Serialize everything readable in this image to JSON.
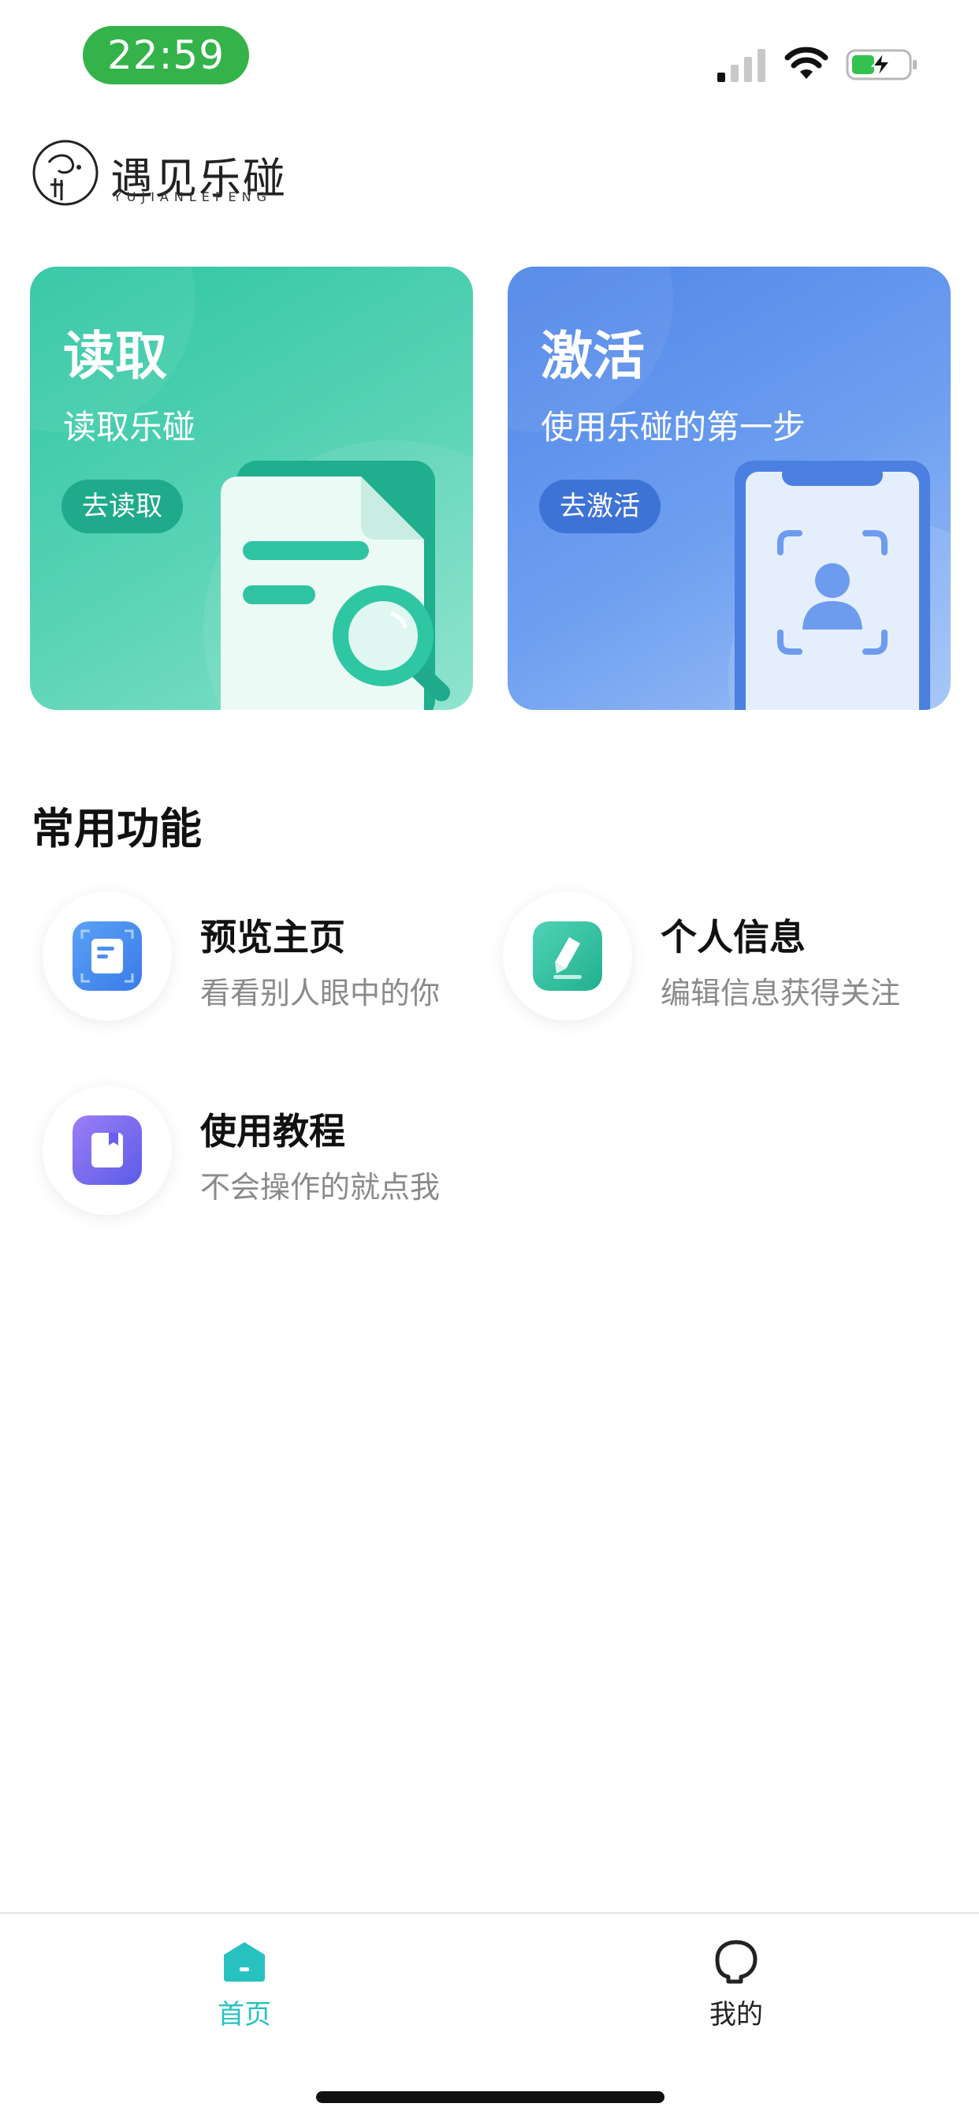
{
  "status_bar": {
    "time": "22:59",
    "icons": [
      "cellular-signal-icon",
      "wifi-icon",
      "battery-charging-icon"
    ],
    "time_pill_color": "#33b34a"
  },
  "logo": {
    "cn": "遇见乐碰",
    "en": "YUJIANLEPENG"
  },
  "cards": [
    {
      "title": "读取",
      "subtitle": "读取乐碰",
      "button": "去读取",
      "icon": "document-search-icon",
      "color": "#2ec6a3"
    },
    {
      "title": "激活",
      "subtitle": "使用乐碰的第一步",
      "button": "去激活",
      "icon": "phone-face-scan-icon",
      "color": "#4f86e8"
    }
  ],
  "section": {
    "title": "常用功能"
  },
  "features": [
    {
      "title": "预览主页",
      "subtitle": "看看别人眼中的你",
      "icon": "preview-page-icon",
      "color": "#4d8ff0"
    },
    {
      "title": "个人信息",
      "subtitle": "编辑信息获得关注",
      "icon": "edit-pencil-icon",
      "color": "#2fc3a2"
    },
    {
      "title": "使用教程",
      "subtitle": "不会操作的就点我",
      "icon": "tutorial-book-icon",
      "color": "#7568f0"
    }
  ],
  "tabbar": {
    "items": [
      {
        "label": "首页",
        "icon": "home-icon",
        "active": true
      },
      {
        "label": "我的",
        "icon": "profile-icon",
        "active": false
      }
    ],
    "active_color": "#27c2c0"
  }
}
